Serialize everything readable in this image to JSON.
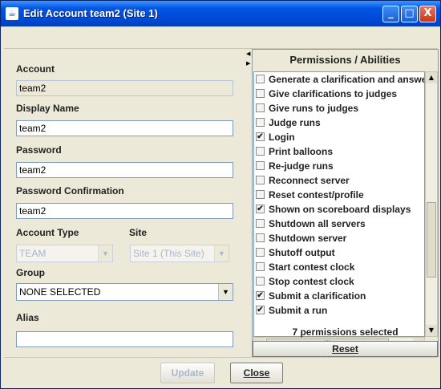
{
  "window": {
    "title": "Edit Account team2 (Site 1)",
    "app_icon": "java-icon",
    "controls": {
      "minimize": "_",
      "maximize": "□",
      "close": "X"
    }
  },
  "form": {
    "account_label": "Account",
    "account_value": "team2",
    "display_name_label": "Display Name",
    "display_name_value": "team2",
    "password_label": "Password",
    "password_value": "team2",
    "password_confirm_label": "Password Confirmation",
    "password_confirm_value": "team2",
    "account_type_label": "Account Type",
    "account_type_value": "TEAM",
    "site_label": "Site",
    "site_value": "Site 1 (This Site)",
    "group_label": "Group",
    "group_value": "NONE SELECTED",
    "alias_label": "Alias",
    "alias_value": ""
  },
  "permissions": {
    "title": "Permissions / Abilities",
    "items": [
      {
        "label": "Generate a clarification and answe",
        "checked": false
      },
      {
        "label": "Give clarifications to judges",
        "checked": false
      },
      {
        "label": "Give runs to judges",
        "checked": false
      },
      {
        "label": "Judge runs",
        "checked": false
      },
      {
        "label": "Login",
        "checked": true
      },
      {
        "label": "Print balloons",
        "checked": false
      },
      {
        "label": "Re-judge runs",
        "checked": false
      },
      {
        "label": "Reconnect server",
        "checked": false
      },
      {
        "label": "Reset contest/profile",
        "checked": false
      },
      {
        "label": "Shown on scoreboard displays",
        "checked": true
      },
      {
        "label": "Shutdown all servers",
        "checked": false
      },
      {
        "label": "Shutdown server",
        "checked": false
      },
      {
        "label": "Shutoff output",
        "checked": false
      },
      {
        "label": "Start contest clock",
        "checked": false
      },
      {
        "label": "Stop contest clock",
        "checked": false
      },
      {
        "label": "Submit a clarification",
        "checked": true
      },
      {
        "label": "Submit a run",
        "checked": true
      }
    ],
    "count_text": "7 permissions selected",
    "reset_label": "Reset",
    "checkmark": "✔",
    "scroll_up": "▲",
    "scroll_down": "▼",
    "scroll_left": "◀",
    "scroll_right": "▶",
    "grip": "|||"
  },
  "buttons": {
    "update_label": "Update",
    "close_label": "Close"
  }
}
